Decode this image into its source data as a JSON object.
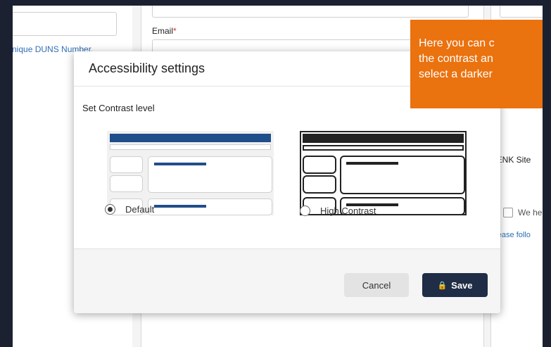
{
  "background": {
    "email_label": "Email",
    "required_marker": "*",
    "duns_text": "nique DUNS Number.",
    "site_text": "RENK Site",
    "we_text": "We he",
    "please_text": "Please follo"
  },
  "modal": {
    "title": "Accessibility settings",
    "subtitle": "Set Contrast level",
    "options": [
      {
        "label": "Default",
        "selected": true
      },
      {
        "label": "High Contrast",
        "selected": false
      }
    ],
    "cancel_label": "Cancel",
    "save_label": "Save",
    "save_icon": "lock-icon"
  },
  "tooltip": {
    "line1": "Here you can c",
    "line2": "the contrast an",
    "line3": "select a darker"
  },
  "colors": {
    "tooltip_bg": "#ea720f",
    "save_bg": "#1f2d46",
    "default_accent": "#1f4e8a",
    "high_contrast_accent": "#222222"
  }
}
